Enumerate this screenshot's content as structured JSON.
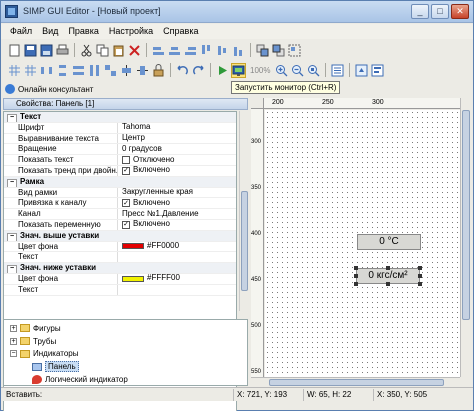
{
  "window": {
    "title": "SIMP GUI Editor - [Новый проект]",
    "buttons": {
      "minimize": "_",
      "maximize": "□",
      "close": "✕"
    }
  },
  "menu": [
    "Файл",
    "Вид",
    "Правка",
    "Настройка",
    "Справка"
  ],
  "toolbar": {
    "zoom_label": "100%",
    "tooltip": "Запустить монитор (Ctrl+R)"
  },
  "consultant": {
    "label": "Онлайн консультант"
  },
  "properties": {
    "header": "Свойства: Панель [1]",
    "rows": [
      {
        "type": "cat",
        "key": "Текст"
      },
      {
        "key": "Шрифт",
        "value": "Tahoma"
      },
      {
        "key": "Выравнивание текста",
        "value": "Центр"
      },
      {
        "key": "Вращение",
        "value": "0 градусов"
      },
      {
        "key": "Показать текст",
        "value": "Отключено",
        "check": ""
      },
      {
        "key": "Показать тренд при двойн...",
        "value": "Включено",
        "check": "✓"
      },
      {
        "type": "cat",
        "key": "Рамка"
      },
      {
        "key": "Вид рамки",
        "value": "Закругленные края"
      },
      {
        "key": "Привязка к каналу",
        "value": "Включено",
        "check": "✓"
      },
      {
        "key": "Канал",
        "value": "Пресс №1.Давление"
      },
      {
        "key": "Показать переменную",
        "value": "Включено",
        "check": "✓"
      },
      {
        "type": "cat",
        "key": "Знач. выше уставки"
      },
      {
        "key": "Цвет фона",
        "value": "#FF0000",
        "swatch": "#e30000"
      },
      {
        "key": "Текст",
        "value": ""
      },
      {
        "type": "cat",
        "key": "Знач. ниже уставки"
      },
      {
        "key": "Цвет фона",
        "value": "#FFFF00",
        "swatch": "#f2f200"
      },
      {
        "key": "Текст",
        "value": ""
      }
    ]
  },
  "tree": [
    {
      "label": "Фигуры",
      "exp": "+",
      "icon": "folder",
      "indent": 0
    },
    {
      "label": "Трубы",
      "exp": "+",
      "icon": "folder",
      "indent": 0
    },
    {
      "label": "Индикаторы",
      "exp": "−",
      "icon": "folder",
      "indent": 0
    },
    {
      "label": "Панель",
      "exp": "",
      "icon": "panel",
      "indent": 1,
      "selected": true
    },
    {
      "label": "Логический индикатор",
      "exp": "",
      "icon": "logic",
      "indent": 1
    }
  ],
  "rulers": {
    "top": [
      "200",
      "250",
      "300"
    ],
    "left": [
      "300",
      "350",
      "400",
      "450",
      "500",
      "550"
    ]
  },
  "canvas": {
    "indicator1": "0 °C",
    "indicator2": "0 кгс/см²"
  },
  "status": {
    "mode": "Вставить:",
    "coords": "X: 721, Y: 193",
    "size": "W: 65, H: 22",
    "pos": "X: 350, Y: 505"
  }
}
